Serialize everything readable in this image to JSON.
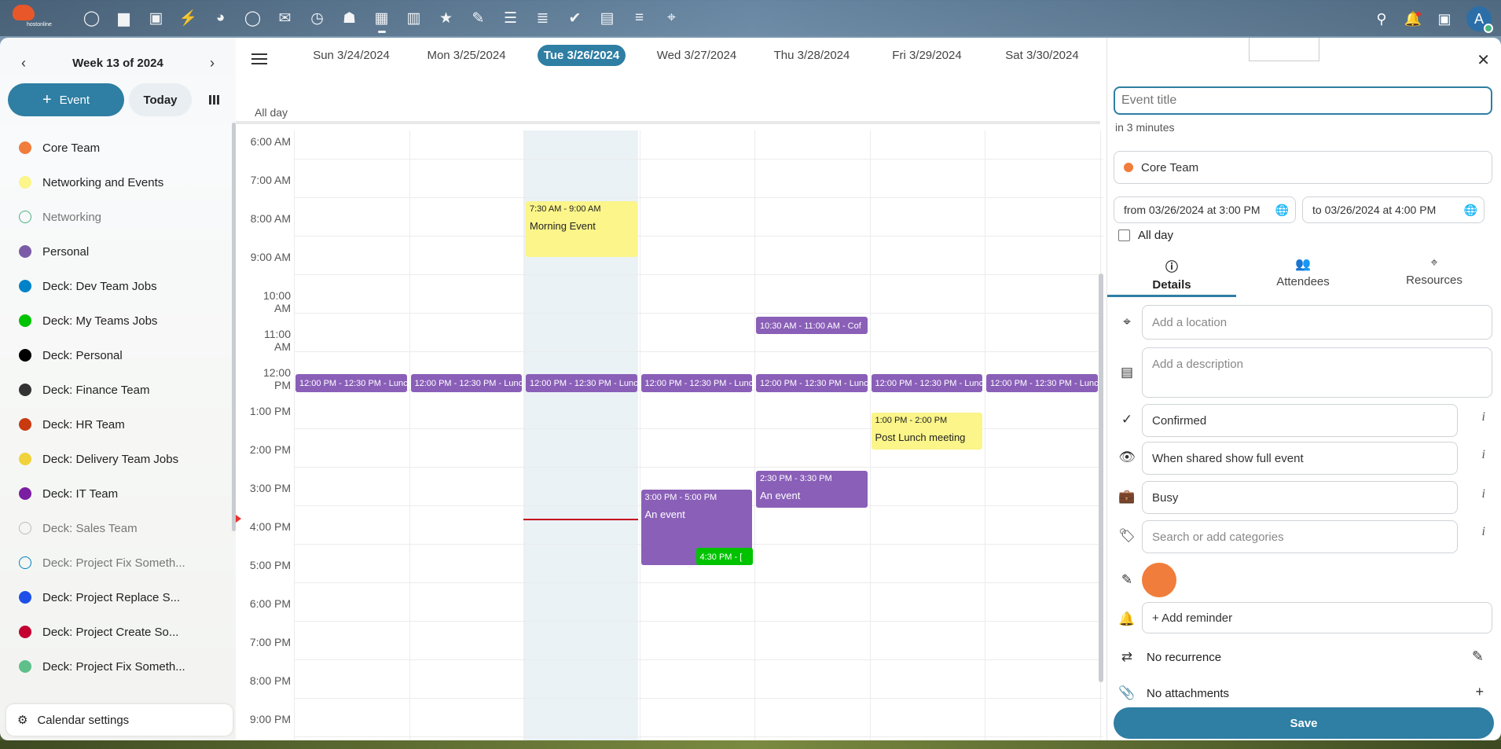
{
  "topbar": {
    "logo_text": "hostonline",
    "apps": [
      {
        "name": "dashboard-icon",
        "glyph": "◯"
      },
      {
        "name": "files-icon",
        "glyph": "▆"
      },
      {
        "name": "photos-icon",
        "glyph": "▣"
      },
      {
        "name": "activity-icon",
        "glyph": "⚡"
      },
      {
        "name": "talk-icon",
        "glyph": "◕"
      },
      {
        "name": "chat-icon",
        "glyph": "◯"
      },
      {
        "name": "mail-icon",
        "glyph": "✉"
      },
      {
        "name": "clock-icon",
        "glyph": "◷"
      },
      {
        "name": "contacts-icon",
        "glyph": "☗"
      },
      {
        "name": "calendar-icon",
        "glyph": "▦",
        "active": true
      },
      {
        "name": "analytics-icon",
        "glyph": "▥"
      },
      {
        "name": "star-icon",
        "glyph": "★"
      },
      {
        "name": "pencil-icon",
        "glyph": "✎"
      },
      {
        "name": "stack-icon",
        "glyph": "☰"
      },
      {
        "name": "list-icon",
        "glyph": "≣"
      },
      {
        "name": "check-icon",
        "glyph": "✔"
      },
      {
        "name": "table-icon",
        "glyph": "▤"
      },
      {
        "name": "text-icon",
        "glyph": "≡"
      },
      {
        "name": "map-pin-icon",
        "glyph": "⌖"
      }
    ]
  },
  "sidebar": {
    "week_label": "Week 13 of 2024",
    "new_event_label": "Event",
    "today_label": "Today",
    "calendars": [
      {
        "name": "Core Team",
        "color": "#f07d3b",
        "hollow": false,
        "dim": false
      },
      {
        "name": "Networking and Events",
        "color": "#fbf58a",
        "hollow": false,
        "dim": false
      },
      {
        "name": "Networking",
        "color": "#49b382",
        "hollow": true,
        "dim": true
      },
      {
        "name": "Personal",
        "color": "#7b5ba8",
        "hollow": false,
        "dim": false
      },
      {
        "name": "Deck: Dev Team Jobs",
        "color": "#0082c9",
        "hollow": false,
        "dim": false
      },
      {
        "name": "Deck: My Teams Jobs",
        "color": "#00c300",
        "hollow": false,
        "dim": false
      },
      {
        "name": "Deck: Personal",
        "color": "#000000",
        "hollow": false,
        "dim": false
      },
      {
        "name": "Deck: Finance Team",
        "color": "#333333",
        "hollow": false,
        "dim": false
      },
      {
        "name": "Deck: HR Team",
        "color": "#c93a10",
        "hollow": false,
        "dim": false
      },
      {
        "name": "Deck: Delivery Team Jobs",
        "color": "#f0d23b",
        "hollow": false,
        "dim": false
      },
      {
        "name": "Deck: IT Team",
        "color": "#7b1fa2",
        "hollow": false,
        "dim": false
      },
      {
        "name": "Deck: Sales Team",
        "color": "#bbbbbb",
        "hollow": true,
        "dim": true
      },
      {
        "name": "Deck: Project Fix Someth...",
        "color": "#0082c9",
        "hollow": true,
        "dim": true
      },
      {
        "name": "Deck: Project Replace S...",
        "color": "#1e4fe8",
        "hollow": false,
        "dim": false
      },
      {
        "name": "Deck: Project Create So...",
        "color": "#c40030",
        "hollow": false,
        "dim": false
      },
      {
        "name": "Deck: Project Fix Someth...",
        "color": "#5fbf8a",
        "hollow": false,
        "dim": false
      }
    ],
    "settings_label": "Calendar settings"
  },
  "calendar": {
    "days": [
      "Sun 3/24/2024",
      "Mon 3/25/2024",
      "Tue 3/26/2024",
      "Wed 3/27/2024",
      "Thu 3/28/2024",
      "Fri 3/29/2024",
      "Sat 3/30/2024"
    ],
    "today_index": 2,
    "all_day_label": "All day",
    "hours": [
      "6:00 AM",
      "7:00 AM",
      "8:00 AM",
      "9:00 AM",
      "10:00 AM",
      "11:00 AM",
      "12:00 PM",
      "1:00 PM",
      "2:00 PM",
      "3:00 PM",
      "4:00 PM",
      "5:00 PM",
      "6:00 PM",
      "7:00 PM",
      "8:00 PM",
      "9:00 PM"
    ],
    "events": [
      {
        "day": 2,
        "start": 7.5,
        "end": 9.0,
        "time": "7:30 AM - 9:00 AM",
        "title": "Morning Event",
        "style": "yellow"
      },
      {
        "day": 4,
        "start": 10.5,
        "end": 11.0,
        "time": "10:30 AM - 11:00 AM - Cof",
        "title": "",
        "style": "purple"
      },
      {
        "day": 0,
        "start": 12.0,
        "end": 12.5,
        "time": "12:00 PM - 12:30 PM - Lunc",
        "title": "",
        "style": "purple"
      },
      {
        "day": 1,
        "start": 12.0,
        "end": 12.5,
        "time": "12:00 PM - 12:30 PM - Lunc",
        "title": "",
        "style": "purple"
      },
      {
        "day": 2,
        "start": 12.0,
        "end": 12.5,
        "time": "12:00 PM - 12:30 PM - Lunc",
        "title": "",
        "style": "purple"
      },
      {
        "day": 3,
        "start": 12.0,
        "end": 12.5,
        "time": "12:00 PM - 12:30 PM - Lunc",
        "title": "",
        "style": "purple"
      },
      {
        "day": 4,
        "start": 12.0,
        "end": 12.5,
        "time": "12:00 PM - 12:30 PM - Lunc",
        "title": "",
        "style": "purple"
      },
      {
        "day": 5,
        "start": 12.0,
        "end": 12.5,
        "time": "12:00 PM - 12:30 PM - Lunc",
        "title": "",
        "style": "purple"
      },
      {
        "day": 6,
        "start": 12.0,
        "end": 12.5,
        "time": "12:00 PM - 12:30 PM - Lunc",
        "title": "",
        "style": "purple"
      },
      {
        "day": 5,
        "start": 13.0,
        "end": 14.0,
        "time": "1:00 PM - 2:00 PM",
        "title": "Post Lunch meeting",
        "style": "yellow"
      },
      {
        "day": 4,
        "start": 14.5,
        "end": 15.5,
        "time": "2:30 PM - 3:30 PM",
        "title": "An event",
        "style": "purple"
      },
      {
        "day": 3,
        "start": 15.0,
        "end": 17.0,
        "time": "3:00 PM - 5:00 PM",
        "title": "An event",
        "style": "purple"
      },
      {
        "day": 3,
        "start": 16.5,
        "end": 17.0,
        "time": "4:30 PM - [",
        "title": "",
        "style": "green",
        "half": true
      }
    ]
  },
  "panel": {
    "title_placeholder": "Event title",
    "relative_time": "in 3 minutes",
    "calendar_value": "Core Team",
    "from_value": "from 03/26/2024 at 3:00 PM",
    "to_value": "to 03/26/2024 at 4:00 PM",
    "all_day_label": "All day",
    "tabs": [
      {
        "label": "Details",
        "icon": "ⓘ"
      },
      {
        "label": "Attendees",
        "icon": "👥"
      },
      {
        "label": "Resources",
        "icon": "⌖"
      }
    ],
    "location_placeholder": "Add a location",
    "description_placeholder": "Add a description",
    "status_value": "Confirmed",
    "visibility_value": "When shared show full event",
    "busy_value": "Busy",
    "categories_placeholder": "Search or add categories",
    "reminder_label": "+ Add reminder",
    "recurrence_label": "No recurrence",
    "attachments_label": "No attachments",
    "save_label": "Save",
    "event_color": "#f07d3b"
  }
}
